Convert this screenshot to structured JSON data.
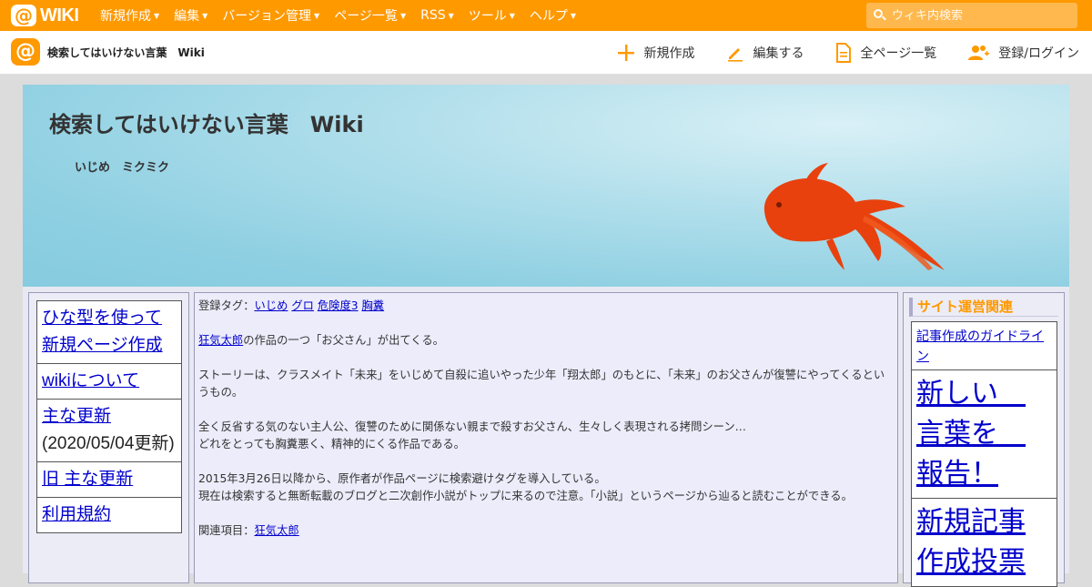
{
  "topbar": {
    "logo_text": "WIKI",
    "menu": [
      {
        "label": "新規作成"
      },
      {
        "label": "編集"
      },
      {
        "label": "バージョン管理"
      },
      {
        "label": "ページ一覧"
      },
      {
        "label": "RSS"
      },
      {
        "label": "ツール"
      },
      {
        "label": "ヘルプ"
      }
    ],
    "search_placeholder": "ウィキ内検索",
    "accent_color": "#ff9900"
  },
  "subbar": {
    "site_name": "検索してはいけない言葉　Wiki",
    "actions": [
      {
        "label": "新規作成",
        "icon": "plus-icon"
      },
      {
        "label": "編集する",
        "icon": "pencil-icon"
      },
      {
        "label": "全ページ一覧",
        "icon": "document-icon"
      },
      {
        "label": "登録/ログイン",
        "icon": "users-icon"
      }
    ]
  },
  "banner": {
    "title": "検索してはいけない言葉　Wiki",
    "subtitle": "いじめ　ミクミク"
  },
  "left_menu": {
    "items": [
      {
        "link": "ひな型を使って新規ページ作成",
        "note": ""
      },
      {
        "link": "wikiについて",
        "note": ""
      },
      {
        "link": "主な更新",
        "note": "(2020/05/04更新)"
      },
      {
        "link": "旧 主な更新",
        "note": ""
      },
      {
        "link": "利用規約",
        "note": ""
      }
    ]
  },
  "main": {
    "tags_label": "登録タグ：",
    "tags": [
      "いじめ",
      "グロ",
      "危険度3",
      "胸糞"
    ],
    "intro_link": "狂気太郎",
    "intro_rest": "の作品の一つ「お父さん」が出てくる。",
    "story": "ストーリーは、クラスメイト「未来」をいじめて自殺に追いやった少年「翔太郎」のもとに、「未来」のお父さんが復讐にやってくるというもの。",
    "para3_line1": "全く反省する気のない主人公、復讐のために関係ない親まで殺すお父さん、生々しく表現される拷問シーン…",
    "para3_line2": "どれをとっても胸糞悪く、精神的にくる作品である。",
    "para4_line1": "2015年3月26日以降から、原作者が作品ページに検索避けタグを導入している。",
    "para4_line2": "現在は検索すると無断転載のブログと二次創作小説がトップに来るので注意。「小説」というページから辿ると読むことができる。",
    "related_label": "関連項目：",
    "related_link": "狂気太郎"
  },
  "right_menu": {
    "heading": "サイト運営関連",
    "items": [
      {
        "label": "記事作成のガイドライン",
        "size": "small"
      },
      {
        "label": "新しい　言葉を　報告！",
        "size": "big"
      },
      {
        "label": "新規記事作成投票",
        "size": "big"
      }
    ]
  }
}
